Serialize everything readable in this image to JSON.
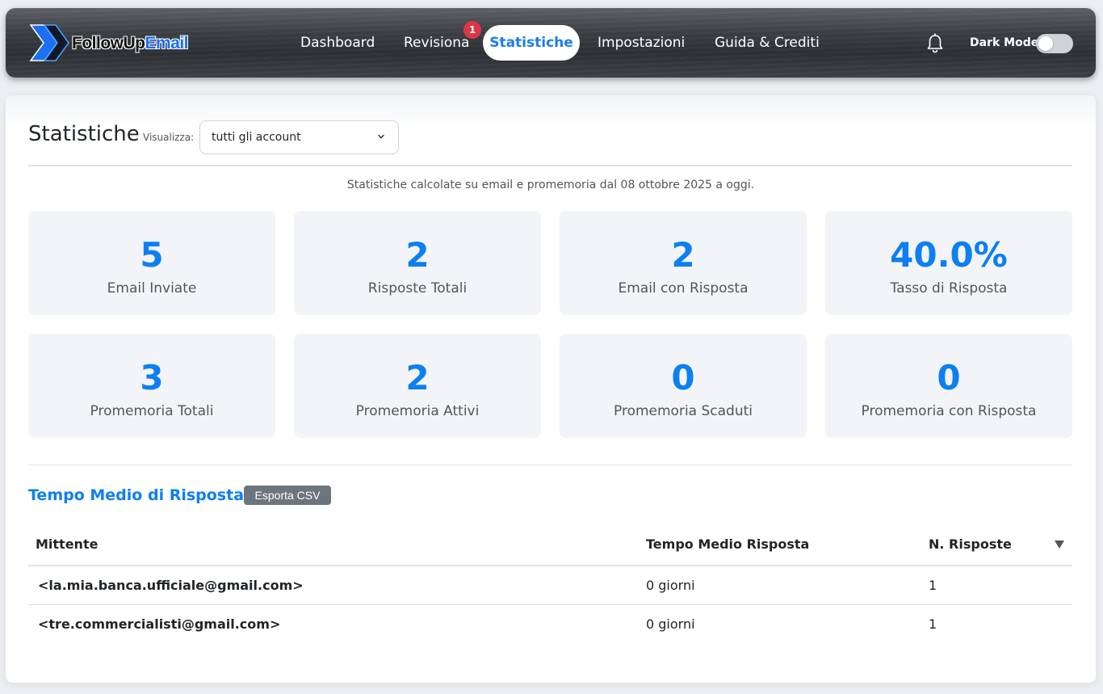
{
  "header": {
    "logo_word1": "FollowUp",
    "logo_word2": "Email",
    "nav": [
      {
        "label": "Dashboard"
      },
      {
        "label": "Revisiona",
        "badge": "1"
      },
      {
        "label": "Statistiche",
        "active": true
      },
      {
        "label": "Impostazioni"
      },
      {
        "label": "Guida & Crediti"
      }
    ],
    "dark_mode_label": "Dark Mode",
    "dark_mode_on": false,
    "icons": {
      "notifications": "bell-icon"
    }
  },
  "page": {
    "title": "Statistiche",
    "view_label": "Visualizza:",
    "account_select": "tutti gli account",
    "subtitle": "Statistiche calcolate su email e promemoria dal 08 ottobre 2025 a oggi."
  },
  "stats": [
    {
      "value": "5",
      "label": "Email Inviate"
    },
    {
      "value": "2",
      "label": "Risposte Totali"
    },
    {
      "value": "2",
      "label": "Email con Risposta"
    },
    {
      "value": "40.0%",
      "label": "Tasso di Risposta"
    },
    {
      "value": "3",
      "label": "Promemoria Totali"
    },
    {
      "value": "2",
      "label": "Promemoria Attivi"
    },
    {
      "value": "0",
      "label": "Promemoria Scaduti"
    },
    {
      "value": "0",
      "label": "Promemoria con Risposta"
    }
  ],
  "response_time": {
    "title": "Tempo Medio di Risposta",
    "export_label": "Esporta CSV",
    "columns": [
      "Mittente",
      "Tempo Medio Risposta",
      "N. Risposte"
    ],
    "rows": [
      {
        "sender": "<la.mia.banca.ufficiale@gmail.com>",
        "avg_time": "0 giorni",
        "count": "1"
      },
      {
        "sender": "<tre.commercialisti@gmail.com>",
        "avg_time": "0 giorni",
        "count": "1"
      }
    ]
  },
  "colors": {
    "accent": "#0d7ff2",
    "badge": "#dc3545",
    "button_secondary": "#6c757d",
    "stat_bg": "#f2f4f7"
  }
}
